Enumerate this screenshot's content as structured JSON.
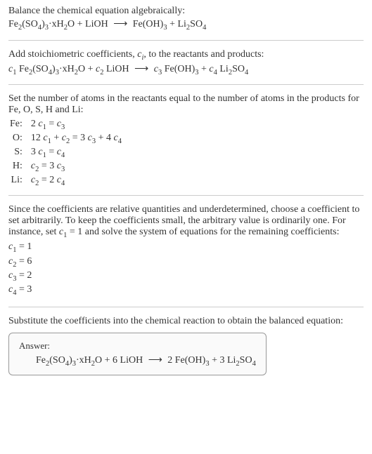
{
  "intro": {
    "line1": "Balance the chemical equation algebraically:",
    "eq": "Fe₂(SO₄)₃·xH₂O + LiOH ⟶ Fe(OH)₃ + Li₂SO₄"
  },
  "step1": {
    "text": "Add stoichiometric coefficients, cᵢ, to the reactants and products:",
    "eq": "c₁ Fe₂(SO₄)₃·xH₂O + c₂ LiOH ⟶ c₃ Fe(OH)₃ + c₄ Li₂SO₄"
  },
  "step2": {
    "text": "Set the number of atoms in the reactants equal to the number of atoms in the products for Fe, O, S, H and Li:",
    "rows": [
      {
        "label": "Fe:",
        "eq": "2 c₁ = c₃"
      },
      {
        "label": "O:",
        "eq": "12 c₁ + c₂ = 3 c₃ + 4 c₄"
      },
      {
        "label": "S:",
        "eq": "3 c₁ = c₄"
      },
      {
        "label": "H:",
        "eq": "c₂ = 3 c₃"
      },
      {
        "label": "Li:",
        "eq": "c₂ = 2 c₄"
      }
    ]
  },
  "step3": {
    "text": "Since the coefficients are relative quantities and underdetermined, choose a coefficient to set arbitrarily. To keep the coefficients small, the arbitrary value is ordinarily one. For instance, set c₁ = 1 and solve the system of equations for the remaining coefficients:",
    "coefs": [
      "c₁ = 1",
      "c₂ = 6",
      "c₃ = 2",
      "c₄ = 3"
    ]
  },
  "step4": {
    "text": "Substitute the coefficients into the chemical reaction to obtain the balanced equation:"
  },
  "answer": {
    "label": "Answer:",
    "eq": "Fe₂(SO₄)₃·xH₂O + 6 LiOH ⟶ 2 Fe(OH)₃ + 3 Li₂SO₄"
  },
  "chart_data": {
    "type": "table",
    "title": "Balanced chemical equation coefficients",
    "reactants": [
      {
        "species": "Fe2(SO4)3·xH2O",
        "coefficient": 1
      },
      {
        "species": "LiOH",
        "coefficient": 6
      }
    ],
    "products": [
      {
        "species": "Fe(OH)3",
        "coefficient": 2
      },
      {
        "species": "Li2SO4",
        "coefficient": 3
      }
    ],
    "atom_balance": [
      {
        "element": "Fe",
        "equation": "2 c1 = c3"
      },
      {
        "element": "O",
        "equation": "12 c1 + c2 = 3 c3 + 4 c4"
      },
      {
        "element": "S",
        "equation": "3 c1 = c4"
      },
      {
        "element": "H",
        "equation": "c2 = 3 c3"
      },
      {
        "element": "Li",
        "equation": "c2 = 2 c4"
      }
    ],
    "solution": {
      "c1": 1,
      "c2": 6,
      "c3": 2,
      "c4": 3
    }
  }
}
